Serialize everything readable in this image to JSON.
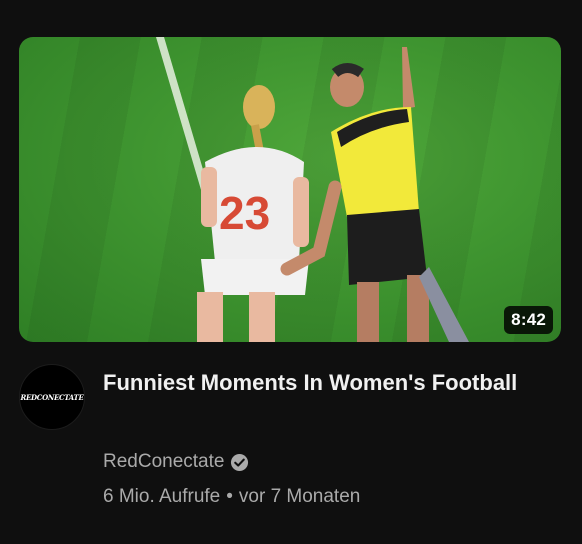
{
  "video": {
    "duration": "8:42",
    "title": "Funniest Moments In Women's Football",
    "jersey_number": "23",
    "channel": {
      "name": "RedConectate",
      "avatar_text": "REDCONECTATE",
      "verified_icon": "verified-check-icon"
    },
    "views": "6 Mio. Aufrufe",
    "separator": "•",
    "age": "vor 7 Monaten"
  }
}
